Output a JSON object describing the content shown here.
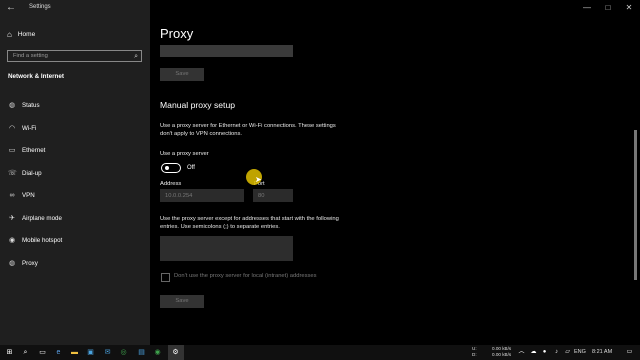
{
  "window": {
    "title": "Settings",
    "back_icon": "arrow-left-icon",
    "controls": [
      "minimize-icon",
      "maximize-icon",
      "close-icon"
    ]
  },
  "sidebar": {
    "home_label": "Home",
    "search_placeholder": "Find a setting",
    "section_title": "Network & Internet",
    "items": [
      {
        "label": "Status",
        "icon": "globe-icon"
      },
      {
        "label": "Wi-Fi",
        "icon": "wifi-icon"
      },
      {
        "label": "Ethernet",
        "icon": "ethernet-icon"
      },
      {
        "label": "Dial-up",
        "icon": "phone-icon"
      },
      {
        "label": "VPN",
        "icon": "vpn-icon"
      },
      {
        "label": "Airplane mode",
        "icon": "airplane-icon"
      },
      {
        "label": "Mobile hotspot",
        "icon": "hotspot-icon"
      },
      {
        "label": "Proxy",
        "icon": "globe-icon"
      }
    ]
  },
  "main": {
    "title": "Proxy",
    "top_save_label": "Save",
    "manual_title": "Manual proxy setup",
    "manual_desc_line1": "Use a proxy server for Ethernet or Wi-Fi connections. These settings",
    "manual_desc_line2": "don't apply to VPN connections.",
    "use_proxy_label": "Use a proxy server",
    "toggle_state": "Off",
    "address_label": "Address",
    "address_value": "10.0.0.254",
    "port_label": "Port",
    "port_value": "80",
    "exceptions_line1": "Use the proxy server except for addresses that start with the following",
    "exceptions_line2": "entries. Use semicolons (;) to separate entries.",
    "local_checkbox_label": "Don't use the proxy server for local (intranet) addresses",
    "bottom_save_label": "Save"
  },
  "taskbar": {
    "network_up": "0.00 kB/s",
    "network_down": "0.00 kB/s",
    "drive_u": "U:",
    "drive_d": "D:",
    "language": "ENG",
    "time": "8:21 AM"
  }
}
